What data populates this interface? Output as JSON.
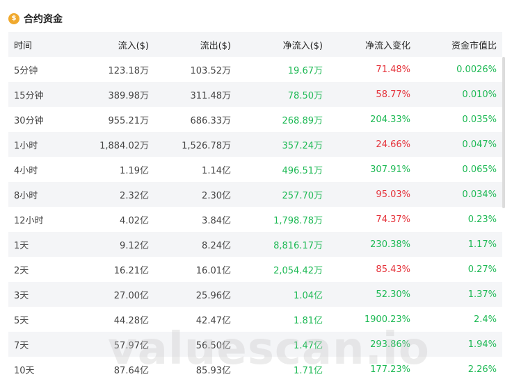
{
  "header": {
    "title": "合约资金",
    "icon": "coin-icon"
  },
  "colors": {
    "positive": "#1DB954",
    "negative": "#E5323A",
    "stripe": "#F4F5F7",
    "icon": "#F0A92E"
  },
  "table": {
    "columns": [
      "时间",
      "流入($)",
      "流出($)",
      "净流入($)",
      "净流入变化",
      "资金市值比"
    ],
    "rows": [
      {
        "cells": [
          "5分钟",
          "123.18万",
          "103.52万",
          "19.67万",
          "71.48%",
          "0.0026%"
        ],
        "change_sign": "negative"
      },
      {
        "cells": [
          "15分钟",
          "389.98万",
          "311.48万",
          "78.50万",
          "58.77%",
          "0.010%"
        ],
        "change_sign": "negative"
      },
      {
        "cells": [
          "30分钟",
          "955.21万",
          "686.33万",
          "268.89万",
          "204.33%",
          "0.035%"
        ],
        "change_sign": "positive"
      },
      {
        "cells": [
          "1小时",
          "1,884.02万",
          "1,526.78万",
          "357.24万",
          "24.66%",
          "0.047%"
        ],
        "change_sign": "negative"
      },
      {
        "cells": [
          "4小时",
          "1.19亿",
          "1.14亿",
          "496.51万",
          "307.91%",
          "0.065%"
        ],
        "change_sign": "positive"
      },
      {
        "cells": [
          "8小时",
          "2.32亿",
          "2.30亿",
          "257.70万",
          "95.03%",
          "0.034%"
        ],
        "change_sign": "negative"
      },
      {
        "cells": [
          "12小时",
          "4.02亿",
          "3.84亿",
          "1,798.78万",
          "74.37%",
          "0.23%"
        ],
        "change_sign": "negative"
      },
      {
        "cells": [
          "1天",
          "9.12亿",
          "8.24亿",
          "8,816.17万",
          "230.38%",
          "1.17%"
        ],
        "change_sign": "positive"
      },
      {
        "cells": [
          "2天",
          "16.21亿",
          "16.01亿",
          "2,054.42万",
          "85.43%",
          "0.27%"
        ],
        "change_sign": "negative"
      },
      {
        "cells": [
          "3天",
          "27.00亿",
          "25.96亿",
          "1.04亿",
          "52.30%",
          "1.37%"
        ],
        "change_sign": "positive"
      },
      {
        "cells": [
          "5天",
          "44.28亿",
          "42.47亿",
          "1.81亿",
          "1900.23%",
          "2.4%"
        ],
        "change_sign": "positive"
      },
      {
        "cells": [
          "7天",
          "57.97亿",
          "56.50亿",
          "1.47亿",
          "293.86%",
          "1.94%"
        ],
        "change_sign": "positive"
      },
      {
        "cells": [
          "10天",
          "87.64亿",
          "85.93亿",
          "1.71亿",
          "177.23%",
          "2.26%"
        ],
        "change_sign": "positive"
      }
    ]
  },
  "watermark": "valuescan.io"
}
